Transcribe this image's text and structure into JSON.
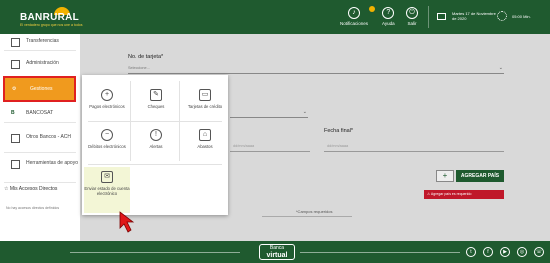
{
  "header": {
    "brand": "BANRURAL",
    "tagline": "El verdadero grupo que nos une a todos",
    "notifications_label": "Notificaciones",
    "help_label": "Ayuda",
    "logout_label": "Salir",
    "date_text": "Martes 17 de Noviembre de 2020",
    "timer": "05:00 Min.",
    "help_icon": "question-icon",
    "logout_icon": "power-icon"
  },
  "sidebar": {
    "items": [
      {
        "label": "Transferencias"
      },
      {
        "label": "Administración"
      },
      {
        "label": "Gestiones",
        "active": true
      },
      {
        "label": "BANCOSAT"
      },
      {
        "label": "Otros Bancos - ACH"
      },
      {
        "label": "Herramientas de apoyo"
      }
    ],
    "accesos_label": "Mis Accesos Directos",
    "accesos_note": "No hay accesos directos definidos",
    "active_color": "#f09a1e"
  },
  "form": {
    "card_label": "No. de tarjeta*",
    "card_placeholder": "Seleccione...",
    "fecha_final_label": "Fecha final*",
    "fecha_inicio_placeholder": "dd/mm/aaaa",
    "fecha_final_placeholder": "dd/mm/aaaa",
    "add_button_icon": "+",
    "add_country_label": "AGREGAR PAÍS",
    "error_text": "Agregar país es requerido",
    "required_note": "*Campos requeridos"
  },
  "popup": {
    "items": [
      {
        "label": "Pagos electrónicos",
        "icon": "coin-plus-icon",
        "glyph": "+"
      },
      {
        "label": "Cheques",
        "icon": "check-pen-icon",
        "glyph": "✎"
      },
      {
        "label": "Tarjetas de crédito",
        "icon": "credit-card-icon",
        "glyph": "▭"
      },
      {
        "label": "Débitos electrónicos",
        "icon": "coin-minus-icon",
        "glyph": "−"
      },
      {
        "label": "Alertas",
        "icon": "alert-icon",
        "glyph": "!"
      },
      {
        "label": "Abastos",
        "icon": "store-icon",
        "glyph": "⌂"
      },
      {
        "label": "Enviar estado de cuenta electrónico",
        "icon": "mail-icon",
        "glyph": "✉"
      }
    ]
  },
  "footer": {
    "virtual_top": "Banca",
    "virtual_main": "virtual",
    "social": [
      "twitter-icon",
      "facebook-icon",
      "youtube-icon",
      "instagram-icon",
      "whatsapp-icon"
    ],
    "social_glyphs": [
      "t",
      "f",
      "▶",
      "◎",
      "☏"
    ]
  },
  "colors": {
    "brand_green": "#1f5a2f",
    "accent_orange": "#f09a1e",
    "error_red": "#c0182a",
    "highlight_red": "#e02020"
  }
}
